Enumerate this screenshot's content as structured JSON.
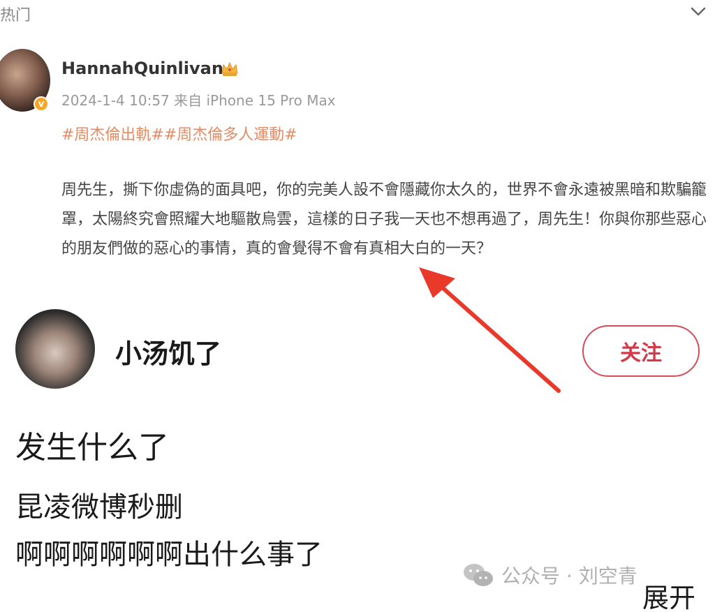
{
  "top_tab": {
    "label": "热门"
  },
  "post": {
    "username": "HannahQuinlivan",
    "meta": "2024-1-4 10:57 来自 iPhone 15 Pro Max",
    "topics": "#周杰倫出軌##周杰倫多人運動#",
    "body": "周先生，撕下你虛偽的面具吧，你的完美人設不會隱藏你太久的，世界不會永遠被黑暗和欺騙籠罩，太陽終究會照耀大地驅散烏雲，這樣的日子我一天也不想再過了，周先生！你與你那些惡心的朋友們做的惡心的事情，真的會覺得不會有真相大白的一天？",
    "badge": "v"
  },
  "user": {
    "name": "小汤饥了",
    "follow_label": "关注"
  },
  "comments": {
    "line1": "发生什么了",
    "line2": "昆凌微博秒删",
    "line3": "啊啊啊啊啊啊出什么事了"
  },
  "watermark": {
    "text": "公众号 · 刘空青"
  },
  "expand_label": "展开",
  "colors": {
    "accent_red": "#d23a4a",
    "topic_orange": "#e58b64",
    "arrow_red": "#e8392b",
    "verify_gold": "#f5a623"
  }
}
